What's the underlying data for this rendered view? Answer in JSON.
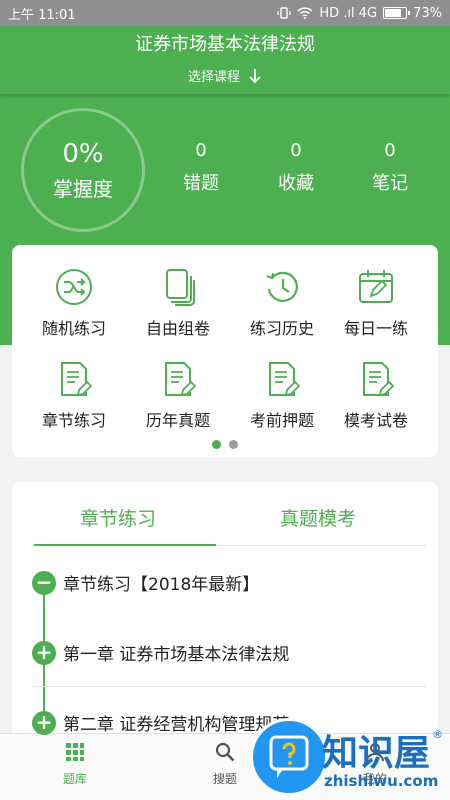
{
  "status_bar": {
    "time": "上午 11:01",
    "indicators": "HD .ıl 4G",
    "battery": "73%",
    "battery_level": 0.73
  },
  "header": {
    "title": "证券市场基本法律法规",
    "course_select": "选择课程",
    "arrow_icon": "arrow-down-icon"
  },
  "mastery": {
    "percent": "0%",
    "label": "掌握度"
  },
  "stats": [
    {
      "value": "0",
      "label": "错题"
    },
    {
      "value": "0",
      "label": "收藏"
    },
    {
      "value": "0",
      "label": "笔记"
    }
  ],
  "grid": [
    {
      "label": "随机练习",
      "icon": "shuffle-icon"
    },
    {
      "label": "自由组卷",
      "icon": "papers-icon"
    },
    {
      "label": "练习历史",
      "icon": "history-icon"
    },
    {
      "label": "每日一练",
      "icon": "calendar-icon"
    },
    {
      "label": "章节练习",
      "icon": "document-edit-icon"
    },
    {
      "label": "历年真题",
      "icon": "document-edit-icon"
    },
    {
      "label": "考前押题",
      "icon": "document-edit-icon"
    },
    {
      "label": "模考试卷",
      "icon": "document-edit-icon"
    }
  ],
  "pager": {
    "active_page": 1,
    "page_count": 2
  },
  "tabs": [
    {
      "label": "章节练习",
      "active": true
    },
    {
      "label": "真题模考",
      "active": false
    }
  ],
  "chapters": [
    {
      "label": "章节练习【2018年最新】",
      "expanded": true
    },
    {
      "label": "第一章 证券市场基本法律法规",
      "expanded": false
    },
    {
      "label": "第二章 证券经营机构管理规范",
      "expanded": false
    }
  ],
  "bottom_nav": [
    {
      "label": "题库",
      "icon": "grid-icon",
      "active": true
    },
    {
      "label": "搜题",
      "icon": "search-icon",
      "active": false
    },
    {
      "label": "我的",
      "icon": "person-icon",
      "active": false
    }
  ],
  "watermark": {
    "text": "知识屋",
    "sub": "zhishiwu.com",
    "reg": "®"
  },
  "colors": {
    "primary": "#4caf50",
    "status_bar": "#8f8f8f",
    "background": "#f2f2f2",
    "watermark": "#1b6fbd"
  }
}
